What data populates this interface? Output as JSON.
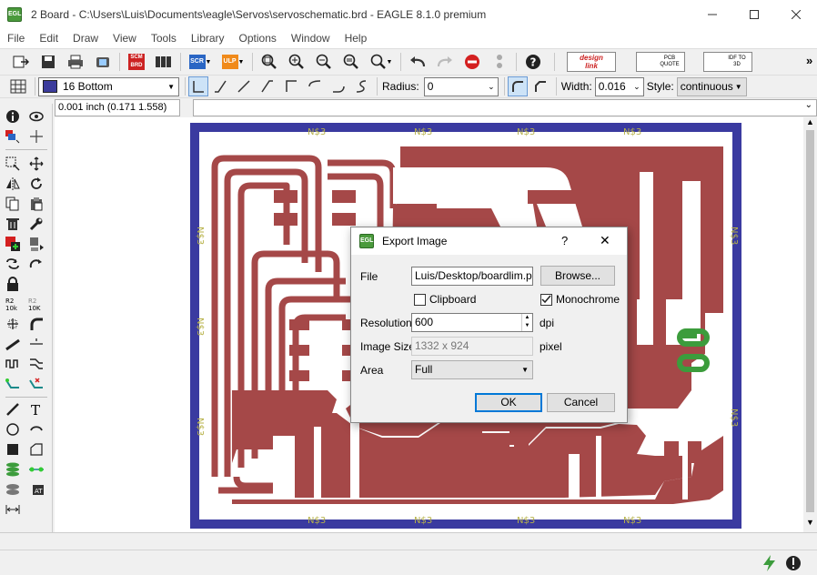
{
  "window": {
    "title": "2 Board - C:\\Users\\Luis\\Documents\\eagle\\Servos\\servoschematic.brd - EAGLE 8.1.0 premium",
    "app_icon": "eagle-app-icon"
  },
  "menu": [
    "File",
    "Edit",
    "Draw",
    "View",
    "Tools",
    "Library",
    "Options",
    "Window",
    "Help"
  ],
  "toolbar": {
    "scm_brd_label": "SCM BRD",
    "scr_label": "SCR",
    "ulp_label": "ULP",
    "design_link_label": "design link",
    "pcb_quote_label": "PCB QUOTE",
    "idf_label": "IDF TO 3D",
    "overflow": "»"
  },
  "paramsbar": {
    "layer": "16 Bottom",
    "layer_color": "#3c3c9c",
    "radius_label": "Radius:",
    "radius_value": "0",
    "width_label": "Width:",
    "width_value": "0.016",
    "style_label": "Style:",
    "style_value": "continuous"
  },
  "coordbar": {
    "coords": "0.001 inch (0.171 1.558)"
  },
  "board": {
    "label": "N$3",
    "outline_color": "#3a3aa0",
    "copper_color": "#a54848",
    "pad_color": "#3c9c3c"
  },
  "dialog": {
    "title": "Export Image",
    "help": "?",
    "close": "✕",
    "file_label": "File",
    "file_value": "Luis/Desktop/boardlim.png",
    "browse_label": "Browse...",
    "clipboard_label": "Clipboard",
    "clipboard_checked": false,
    "monochrome_label": "Monochrome",
    "monochrome_checked": true,
    "resolution_label": "Resolution",
    "resolution_value": "600",
    "resolution_unit": "dpi",
    "imagesize_label": "Image Size",
    "imagesize_value": "1332 x 924",
    "imagesize_unit": "pixel",
    "area_label": "Area",
    "area_value": "Full",
    "ok_label": "OK",
    "cancel_label": "Cancel"
  }
}
